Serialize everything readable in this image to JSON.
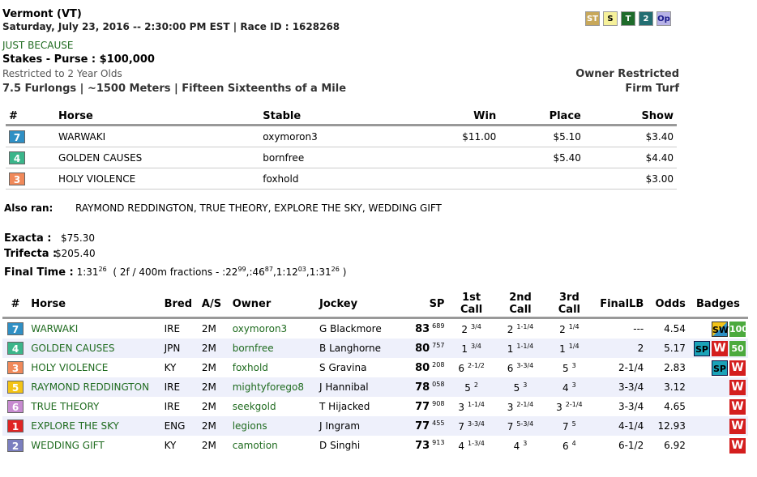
{
  "header": {
    "track": "Vermont (VT)",
    "datetime": "Saturday, July 23, 2016 -- 2:30:00 PM EST | Race ID : 1628268",
    "race_name": "JUST BECAUSE",
    "stakes": "Stakes - Purse : $100,000",
    "restriction": "Restricted to 2 Year Olds",
    "distance": "7.5 Furlongs | ~1500 Meters | Fifteen Sixteenths of a Mile",
    "owner_restricted": "Owner Restricted",
    "surface": "Firm Turf"
  },
  "legend": [
    {
      "label": "ST",
      "bg": "#c8a85a",
      "fg": "#fff"
    },
    {
      "label": "S",
      "bg": "#f6f19a",
      "fg": "#000"
    },
    {
      "label": "T",
      "bg": "#1e6b2a",
      "fg": "#fff"
    },
    {
      "label": "2",
      "bg": "#236e72",
      "fg": "#fff"
    },
    {
      "label": "Op",
      "bg": "#b7b2e6",
      "fg": "#1a1a8a"
    }
  ],
  "results": {
    "headers": [
      "#",
      "Horse",
      "Stable",
      "Win",
      "Place",
      "Show"
    ],
    "rows": [
      {
        "pp": "7",
        "color": "#2f8fc4",
        "horse": "WARWAKI",
        "stable": "oxymoron3",
        "win": "$11.00",
        "place": "$5.10",
        "show": "$3.40"
      },
      {
        "pp": "4",
        "color": "#3bb58a",
        "horse": "GOLDEN CAUSES",
        "stable": "bornfree",
        "win": "",
        "place": "$5.40",
        "show": "$4.40"
      },
      {
        "pp": "3",
        "color": "#f0895a",
        "horse": "HOLY VIOLENCE",
        "stable": "foxhold",
        "win": "",
        "place": "",
        "show": "$3.00"
      }
    ]
  },
  "also_ran": {
    "label": "Also ran:",
    "value": "RAYMOND REDDINGTON, TRUE THEORY, EXPLORE THE SKY, WEDDING GIFT"
  },
  "exotics": {
    "exacta_label": "Exacta :",
    "exacta_value": "$75.30",
    "trifecta_label": "Trifecta :",
    "trifecta_value": "$205.40"
  },
  "final_time": {
    "label": "Final Time :",
    "time": "1:31",
    "time_sup": "26",
    "fractions_prefix": "( 2f / 400m fractions - :22",
    "f1_sup": "99",
    "f2": ",:46",
    "f2_sup": "87",
    "f3": ",1:12",
    "f3_sup": "03",
    "f4": ",1:31",
    "f4_sup": "26",
    "close": ")"
  },
  "field": {
    "headers": [
      "#",
      "Horse",
      "Bred",
      "A/S",
      "Owner",
      "Jockey",
      "SP",
      "1st Call",
      "2nd Call",
      "3rd Call",
      "FinalLB",
      "Odds",
      "Badges"
    ],
    "rows": [
      {
        "pp": "7",
        "color": "#2f8fc4",
        "horse": "WARWAKI",
        "bred": "IRE",
        "as": "2M",
        "owner": "oxymoron3",
        "jockey": "G Blackmore",
        "sp": "83",
        "sp_sup": "689",
        "c1": "2",
        "c1s": "3/4",
        "c2": "2",
        "c2s": "1-1/4",
        "c3": "2",
        "c3s": "1/4",
        "final": "---",
        "odds": "4.54",
        "badges": [
          "SW",
          "100"
        ]
      },
      {
        "pp": "4",
        "color": "#3bb58a",
        "horse": "GOLDEN CAUSES",
        "bred": "JPN",
        "as": "2M",
        "owner": "bornfree",
        "jockey": "B Langhorne",
        "sp": "80",
        "sp_sup": "757",
        "c1": "1",
        "c1s": "3/4",
        "c2": "1",
        "c2s": "1-1/4",
        "c3": "1",
        "c3s": "1/4",
        "final": "2",
        "odds": "5.17",
        "badges": [
          "SP",
          "W",
          "50"
        ]
      },
      {
        "pp": "3",
        "color": "#f0895a",
        "horse": "HOLY VIOLENCE",
        "bred": "KY",
        "as": "2M",
        "owner": "foxhold",
        "jockey": "S Gravina",
        "sp": "80",
        "sp_sup": "208",
        "c1": "6",
        "c1s": "2-1/2",
        "c2": "6",
        "c2s": "3-3/4",
        "c3": "5",
        "c3s": "3",
        "final": "2-1/4",
        "odds": "2.83",
        "badges": [
          "SP",
          "W"
        ]
      },
      {
        "pp": "5",
        "color": "#f3c316",
        "horse": "RAYMOND REDDINGTON",
        "bred": "IRE",
        "as": "2M",
        "owner": "mightyforego8",
        "jockey": "J Hannibal",
        "sp": "78",
        "sp_sup": "058",
        "c1": "5",
        "c1s": "2",
        "c2": "5",
        "c2s": "3",
        "c3": "4",
        "c3s": "3",
        "final": "3-3/4",
        "odds": "3.12",
        "badges": [
          "W"
        ]
      },
      {
        "pp": "6",
        "color": "#c78ad0",
        "horse": "TRUE THEORY",
        "bred": "IRE",
        "as": "2M",
        "owner": "seekgold",
        "jockey": "T Hijacked",
        "sp": "77",
        "sp_sup": "908",
        "c1": "3",
        "c1s": "1-1/4",
        "c2": "3",
        "c2s": "2-1/4",
        "c3": "3",
        "c3s": "2-1/4",
        "final": "3-3/4",
        "odds": "4.65",
        "badges": [
          "W"
        ]
      },
      {
        "pp": "1",
        "color": "#e02424",
        "horse": "EXPLORE THE SKY",
        "bred": "ENG",
        "as": "2M",
        "owner": "legions",
        "jockey": "J Ingram",
        "sp": "77",
        "sp_sup": "455",
        "c1": "7",
        "c1s": "3-3/4",
        "c2": "7",
        "c2s": "5-3/4",
        "c3": "7",
        "c3s": "5",
        "final": "4-1/4",
        "odds": "12.93",
        "badges": [
          "W"
        ]
      },
      {
        "pp": "2",
        "color": "#7b7fbf",
        "horse": "WEDDING GIFT",
        "bred": "KY",
        "as": "2M",
        "owner": "camotion",
        "jockey": "D Singhi",
        "sp": "73",
        "sp_sup": "913",
        "c1": "4",
        "c1s": "1-3/4",
        "c2": "4",
        "c2s": "3",
        "c3": "6",
        "c3s": "4",
        "final": "6-1/2",
        "odds": "6.92",
        "badges": [
          "W"
        ]
      }
    ]
  }
}
